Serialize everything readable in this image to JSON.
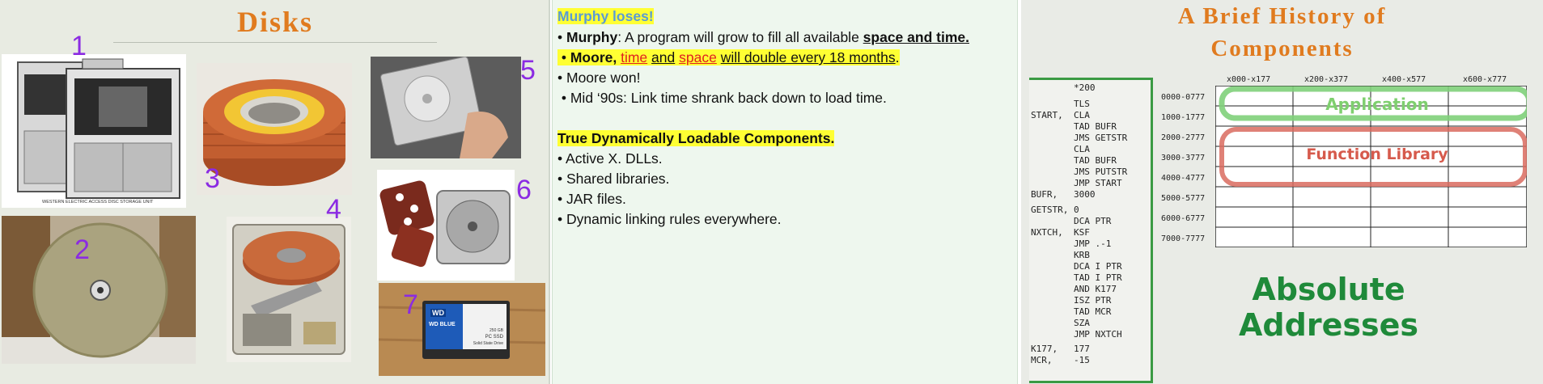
{
  "left_slide": {
    "title": "Disks",
    "photo_numbers": [
      "1",
      "2",
      "3",
      "4",
      "5",
      "6",
      "7"
    ],
    "photo1_caption": "WESTERN ELECTRIC ACCESS DISC STORAGE UNIT",
    "photo7_brand": "WD",
    "photo7_product": "WD BLUE",
    "photo7_capacity": "250 GB",
    "photo7_desc1": "PC SSD",
    "photo7_desc2": "Solid State Drive"
  },
  "middle_slide": {
    "heading1": "Murphy loses!",
    "l1_bold": "Murphy",
    "l1_text": ":  A program will grow to fill all available ",
    "l1_under": "space and time.",
    "l2_bold": "Moore,",
    "l2_time": "time",
    "l2_and": "and",
    "l2_space": "space",
    "l2_rest": "will double every 18 months",
    "l2_dot": ".",
    "l3": "Moore won!",
    "l4": "Mid ‘90s: Link time shrank back down to load time.",
    "heading2": "True Dynamically Loadable Components.",
    "bullets": [
      "Active X.  DLLs.",
      "Shared libraries.",
      "JAR files.",
      "Dynamic linking rules everywhere."
    ]
  },
  "right_slide": {
    "title_line1": "A Brief History of",
    "title_line2": "Components",
    "code_lines": [
      "        *200",
      "",
      "        TLS",
      "START,  CLA",
      "        TAD BUFR",
      "        JMS GETSTR",
      "        CLA",
      "        TAD BUFR",
      "        JMS PUTSTR",
      "        JMP START",
      "BUFR,   3000",
      "GETSTR, 0",
      "        DCA PTR",
      "NXTCH,  KSF",
      "        JMP .-1",
      "        KRB",
      "        DCA I PTR",
      "        TAD I PTR",
      "        AND K177",
      "        ISZ PTR",
      "        TAD MCR",
      "        SZA",
      "        JMP NXTCH",
      "K177,   177",
      "MCR,    -15"
    ],
    "column_labels": [
      "x000-x177",
      "x200-x377",
      "x400-x577",
      "x600-x777"
    ],
    "row_labels": [
      "0000-0777",
      "1000-1777",
      "2000-2777",
      "3000-3777",
      "4000-4777",
      "5000-5777",
      "6000-6777",
      "7000-7777"
    ],
    "application_label": "Application",
    "library_label": "Function Library",
    "caption_line1": "Absolute",
    "caption_line2": "Addresses",
    "colors": {
      "title": "#e07b1f",
      "green": "#3aa845",
      "red": "#d45a4c"
    }
  }
}
